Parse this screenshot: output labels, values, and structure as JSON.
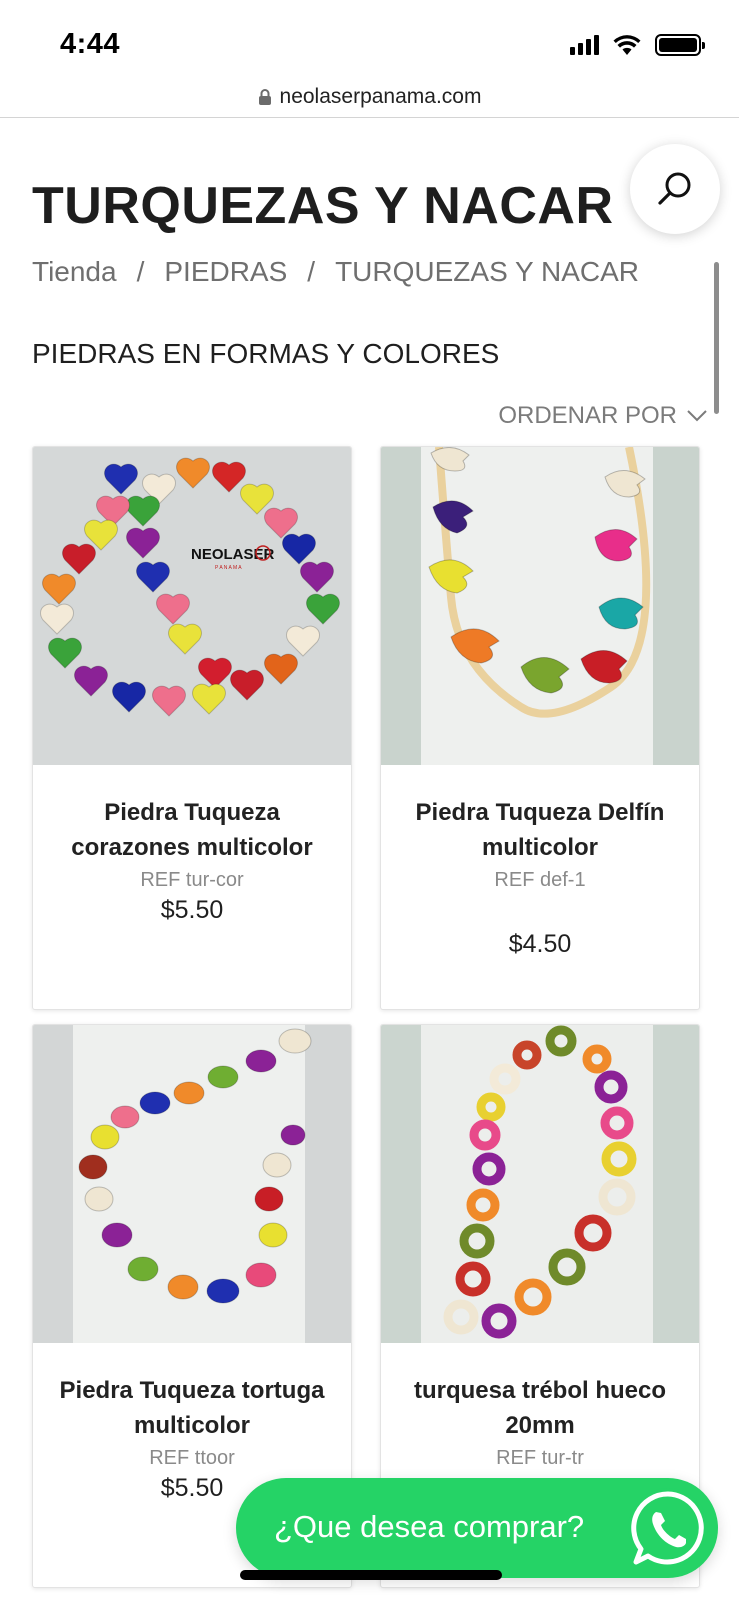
{
  "status_bar": {
    "time": "4:44",
    "icons": [
      "signal-icon",
      "wifi-icon",
      "battery-icon"
    ]
  },
  "browser": {
    "url": "neolaserpanama.com",
    "icon": "lock-icon"
  },
  "page": {
    "title": "TURQUEZAS Y NACAR",
    "breadcrumb": [
      "Tienda",
      "PIEDRAS",
      "TURQUEZAS Y NACAR"
    ],
    "breadcrumb_separator": "/",
    "subcategory": "PIEDRAS EN FORMAS Y COLORES",
    "sort_label": "ORDENAR POR"
  },
  "products": [
    {
      "name": "Piedra Tuqueza corazones multicolor",
      "ref": "REF tur-cor",
      "price": "$5.50",
      "image": "hearts-bracelet-photo"
    },
    {
      "name": "Piedra Tuqueza Delfín multicolor",
      "ref": "REF def-1",
      "price": "$4.50",
      "image": "dolphin-strand-photo"
    },
    {
      "name": "Piedra Tuqueza tortuga multicolor",
      "ref": "REF ttoor",
      "price": "$5.50",
      "image": "turtle-necklace-photo"
    },
    {
      "name": "turquesa trébol hueco 20mm",
      "ref": "REF tur-tr",
      "price": "",
      "image": "clover-strand-photo"
    }
  ],
  "logo_text": "NEOLASER PANAMA",
  "whatsapp": {
    "label": "¿Que desea comprar?",
    "color": "#25d366"
  },
  "colors": {
    "accent": "#25d366",
    "text": "#1e1e1e",
    "muted": "#6f6f6f"
  }
}
